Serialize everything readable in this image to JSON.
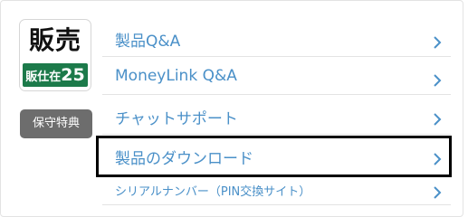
{
  "logo": {
    "main_text": "販売",
    "band_text": "販仕在",
    "band_number": "25"
  },
  "badge": {
    "label": "保守特典"
  },
  "menu": {
    "items": [
      {
        "label": "製品Q&A"
      },
      {
        "label": "MoneyLink Q&A"
      },
      {
        "label": "チャットサポート"
      },
      {
        "label": "製品のダウンロード"
      },
      {
        "label": "シリアルナンバー（PIN交換サイト）"
      }
    ]
  },
  "colors": {
    "link": "#4a90c8",
    "logo_band": "#1c7a4a",
    "badge_bg": "#6d6d6d",
    "highlight_border": "#000000"
  },
  "icons": {
    "row_arrow": "chevron-right-icon"
  }
}
